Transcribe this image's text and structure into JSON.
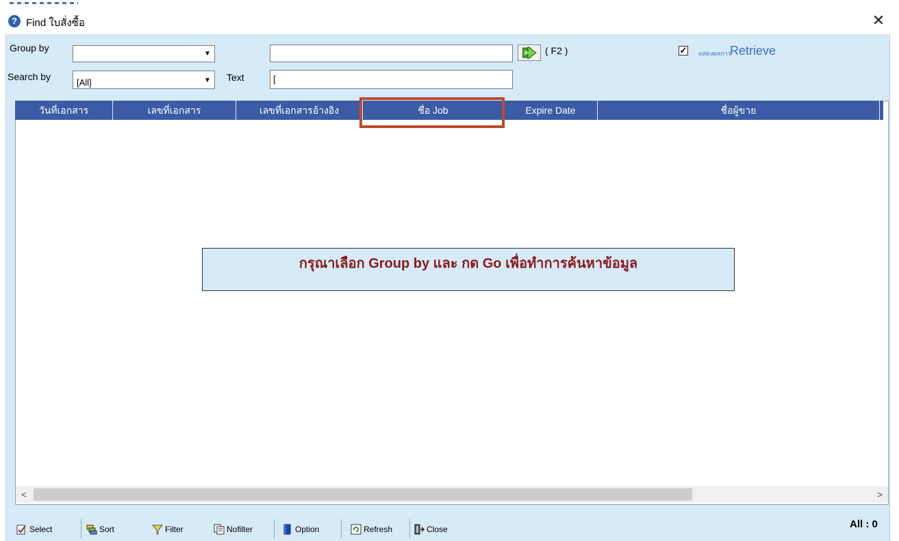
{
  "window": {
    "title": "Find ใบสั่งซื้อ",
    "close_glyph": "✕",
    "help_glyph": "?"
  },
  "filters": {
    "group_by_label": "Group by",
    "group_by_value": "",
    "search_by_label": "Search by",
    "search_by_value": "[All]",
    "text_label": "Text",
    "top_input_value": "",
    "text_input_value": "[",
    "go_shortcut": "( F2 )"
  },
  "retrieve_option": {
    "checked_glyph": "✓",
    "small_label": "แสดงผลการ",
    "label": "Retrieve"
  },
  "grid": {
    "columns": [
      "วันที่เอกสาร",
      "เลขที่เอกสาร",
      "เลขที่เอกสารอ้างอิง",
      "ชื่อ Job",
      "Expire Date",
      "ชื่อผู้ขาย"
    ],
    "message": "กรุณาเลือก Group  by และ กด Go เพื่อทำการค้นหาข้อมูล",
    "scroll_left": "<",
    "scroll_right": ">"
  },
  "toolbar": {
    "select": "Select",
    "sort": "Sort",
    "filter": "Filter",
    "nofilter": "Nofilter",
    "option": "Option",
    "refresh": "Refresh",
    "close": "Close",
    "count": "All : 0"
  },
  "colors": {
    "panel_bg": "#d6eaf8",
    "header_bg": "#3b5ba5",
    "highlight_border": "#c04a2e",
    "message_text": "#8b1a1a",
    "accent_blue": "#3a6fc0"
  }
}
